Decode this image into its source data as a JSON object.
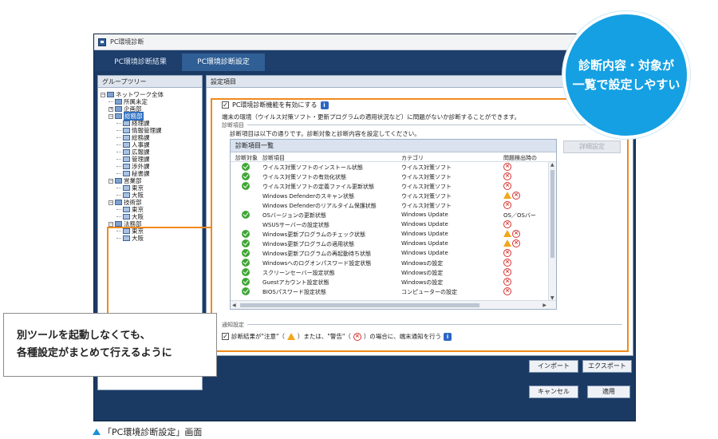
{
  "window": {
    "title": "PC環境診断",
    "tabs": [
      {
        "label": "PC環境診断結果"
      },
      {
        "label": "PC環境診断設定"
      }
    ]
  },
  "tree_panel": {
    "header": "グループツリー",
    "nodes": [
      {
        "label": "ネットワーク全体",
        "level": 0,
        "expander": "−",
        "selected": false
      },
      {
        "label": "所属未定",
        "level": 1,
        "expander": "",
        "selected": false
      },
      {
        "label": "企画部",
        "level": 1,
        "expander": "+",
        "selected": false
      },
      {
        "label": "総務部",
        "level": 1,
        "expander": "−",
        "selected": true
      },
      {
        "label": "経理課",
        "level": 2,
        "expander": "",
        "selected": false
      },
      {
        "label": "情報管理課",
        "level": 2,
        "expander": "",
        "selected": false
      },
      {
        "label": "総務課",
        "level": 2,
        "expander": "",
        "selected": false
      },
      {
        "label": "人事課",
        "level": 2,
        "expander": "",
        "selected": false
      },
      {
        "label": "広報課",
        "level": 2,
        "expander": "",
        "selected": false
      },
      {
        "label": "管理課",
        "level": 2,
        "expander": "",
        "selected": false
      },
      {
        "label": "渉外課",
        "level": 2,
        "expander": "",
        "selected": false
      },
      {
        "label": "秘書課",
        "level": 2,
        "expander": "",
        "selected": false
      },
      {
        "label": "営業部",
        "level": 1,
        "expander": "−",
        "selected": false
      },
      {
        "label": "東京",
        "level": 2,
        "expander": "",
        "selected": false
      },
      {
        "label": "大阪",
        "level": 2,
        "expander": "",
        "selected": false
      },
      {
        "label": "技術部",
        "level": 1,
        "expander": "−",
        "selected": false
      },
      {
        "label": "東京",
        "level": 2,
        "expander": "",
        "selected": false
      },
      {
        "label": "大阪",
        "level": 2,
        "expander": "",
        "selected": false
      },
      {
        "label": "法務部",
        "level": 1,
        "expander": "−",
        "selected": false
      },
      {
        "label": "東京",
        "level": 2,
        "expander": "",
        "selected": false
      },
      {
        "label": "大阪",
        "level": 2,
        "expander": "",
        "selected": false
      }
    ]
  },
  "settings": {
    "header": "設定項目",
    "enable_label": "PC環境診断機能を有効にする",
    "description": "端末の環境（ウイルス対策ソフト・更新プログラムの適用状況など）に問題がないか診断することができます。",
    "section_diagnosis": "診断項目",
    "diagnosis_desc": "診断項目は以下の通りです。診断対象と診断内容を設定してください。",
    "table_title": "診断項目一覧",
    "detail_button": "詳細設定",
    "columns": {
      "target": "診断対象",
      "item": "診断項目",
      "category": "カテゴリ",
      "condition": "問題検出時の"
    },
    "rows": [
      {
        "checked": true,
        "item": "ウイルス対策ソフトのインストール状態",
        "category": "ウイルス対策ソフト",
        "cond": [
          "error"
        ]
      },
      {
        "checked": true,
        "item": "ウイルス対策ソフトの有効化状態",
        "category": "ウイルス対策ソフト",
        "cond": [
          "error"
        ]
      },
      {
        "checked": true,
        "item": "ウイルス対策ソフトの定義ファイル更新状態",
        "category": "ウイルス対策ソフト",
        "cond": [
          "error"
        ]
      },
      {
        "checked": false,
        "item": "Windows Defenderのスキャン状態",
        "category": "ウイルス対策ソフト",
        "cond": [
          "warning",
          "error"
        ]
      },
      {
        "checked": false,
        "item": "Windows Defenderのリアルタイム保護状態",
        "category": "ウイルス対策ソフト",
        "cond": [
          "error"
        ]
      },
      {
        "checked": true,
        "item": "OSバージョンの更新状態",
        "category": "Windows Update",
        "cond_text": "OS／OSバー"
      },
      {
        "checked": false,
        "item": "WSUSサーバーの設定状態",
        "category": "Windows Update",
        "cond": [
          "error"
        ]
      },
      {
        "checked": true,
        "item": "Windows更新プログラムのチェック状態",
        "category": "Windows Update",
        "cond": [
          "warning",
          "error"
        ]
      },
      {
        "checked": true,
        "item": "Windows更新プログラムの適用状態",
        "category": "Windows Update",
        "cond": [
          "warning",
          "error"
        ]
      },
      {
        "checked": true,
        "item": "Windows更新プログラムの再起動待ち状態",
        "category": "Windows Update",
        "cond": [
          "error"
        ]
      },
      {
        "checked": true,
        "item": "Windowsへのログオンパスワード設定状態",
        "category": "Windowsの設定",
        "cond": [
          "error"
        ]
      },
      {
        "checked": true,
        "item": "スクリーンセーバー設定状態",
        "category": "Windowsの設定",
        "cond": [
          "error"
        ]
      },
      {
        "checked": true,
        "item": "Guestアカウント設定状態",
        "category": "Windowsの設定",
        "cond": [
          "error"
        ]
      },
      {
        "checked": true,
        "item": "BIOSパスワード設定状態",
        "category": "コンピューターの設定",
        "cond": [
          "error"
        ]
      }
    ],
    "section_notify": "通知設定",
    "notify_text_1": "診断結果が\"注意\"（",
    "notify_text_2": "）または、\"警告\"（",
    "notify_text_3": "）の場合に、端末通知を行う"
  },
  "buttons": {
    "import": "インポート",
    "export": "エクスポート",
    "cancel": "キャンセル",
    "apply": "適用"
  },
  "callouts": {
    "bubble_line1": "診断内容・対象が",
    "bubble_line2": "一覧で設定しやすい",
    "note_line1": "別ツールを起動しなくても、",
    "note_line2": "各種設定がまとめて行えるように"
  },
  "caption": "「PC環境診断設定」画面",
  "colors": {
    "accent_orange": "#f08a1c",
    "bubble_blue": "#14a0e3",
    "window_navy": "#1b3a63",
    "ok_green": "#3fa635",
    "error_red": "#d8322f",
    "warning_yellow": "#f2a71b"
  }
}
